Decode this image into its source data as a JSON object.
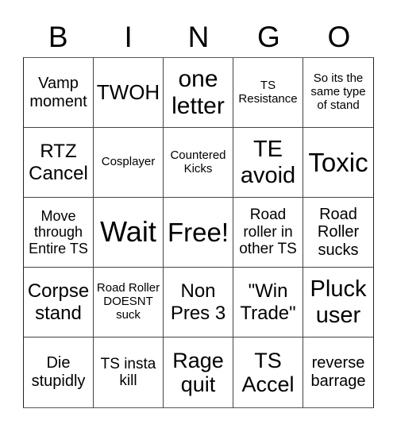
{
  "header": {
    "letters": [
      "B",
      "I",
      "N",
      "G",
      "O"
    ]
  },
  "board": {
    "rows": [
      [
        "Vamp moment",
        "TWOH",
        "one letter",
        "TS Resistance",
        "So its the same type of stand"
      ],
      [
        "RTZ Cancel",
        "Cosplayer",
        "Countered Kicks",
        "TE avoid",
        "Toxic"
      ],
      [
        "Move through Entire TS",
        "Wait",
        "Free!",
        "Road roller in other TS",
        "Road Roller sucks"
      ],
      [
        "Corpse stand",
        "Road Roller DOESNT suck",
        "Non Pres 3",
        "\"Win Trade\"",
        "Pluck user"
      ],
      [
        "Die stupidly",
        "TS insta kill",
        "Rage quit",
        "TS Accel",
        "reverse barrage"
      ]
    ]
  }
}
